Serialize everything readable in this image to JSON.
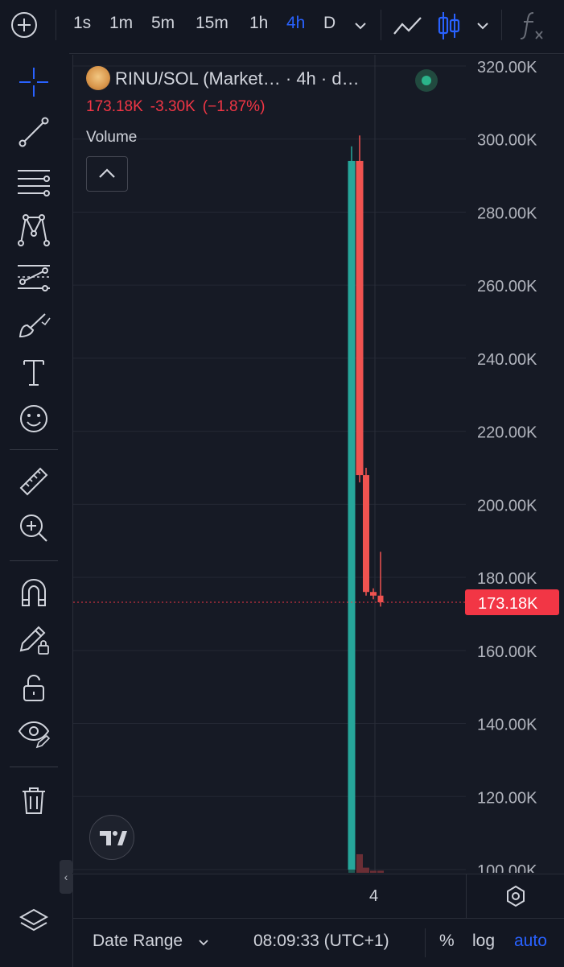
{
  "toolbar": {
    "intervals": [
      "1s",
      "1m",
      "5m",
      "15m",
      "1h",
      "4h",
      "D"
    ],
    "active_interval": "4h"
  },
  "legend": {
    "title": "RINU/SOL (Market… · 4h · d…",
    "last_price": "173.18K",
    "change": "-3.30K",
    "change_pct": "(−1.87%)",
    "volume_label": "Volume",
    "status_color": "#2bb38a"
  },
  "chart_data": {
    "type": "candlestick",
    "y_axis_labels": [
      "320.00K",
      "300.00K",
      "280.00K",
      "260.00K",
      "240.00K",
      "220.00K",
      "200.00K",
      "180.00K",
      "160.00K",
      "140.00K",
      "120.00K",
      "100.00K"
    ],
    "ylim": [
      100000,
      320000
    ],
    "x_tick_labels": [
      "4"
    ],
    "current_price_label": "173.18K",
    "candles": [
      {
        "open": 100000,
        "high": 298000,
        "low": 100000,
        "close": 294000,
        "direction": "up"
      },
      {
        "open": 294000,
        "high": 301000,
        "low": 206000,
        "close": 208000,
        "direction": "down"
      },
      {
        "open": 208000,
        "high": 210000,
        "low": 175000,
        "close": 176000,
        "direction": "down"
      },
      {
        "open": 176000,
        "high": 177000,
        "low": 174000,
        "close": 175000,
        "direction": "down"
      },
      {
        "open": 175000,
        "high": 187000,
        "low": 172000,
        "close": 173180,
        "direction": "down"
      }
    ],
    "volumes": [
      100,
      36,
      10,
      4,
      4
    ],
    "colors": {
      "up": "#26a69a",
      "down": "#ef5350",
      "grid": "#242834",
      "price_line": "#f23645"
    }
  },
  "time_axis": {
    "label": "4"
  },
  "bottom": {
    "date_range": "Date Range",
    "clock": "08:09:33 (UTC+1)",
    "percent": "%",
    "log": "log",
    "auto": "auto"
  }
}
